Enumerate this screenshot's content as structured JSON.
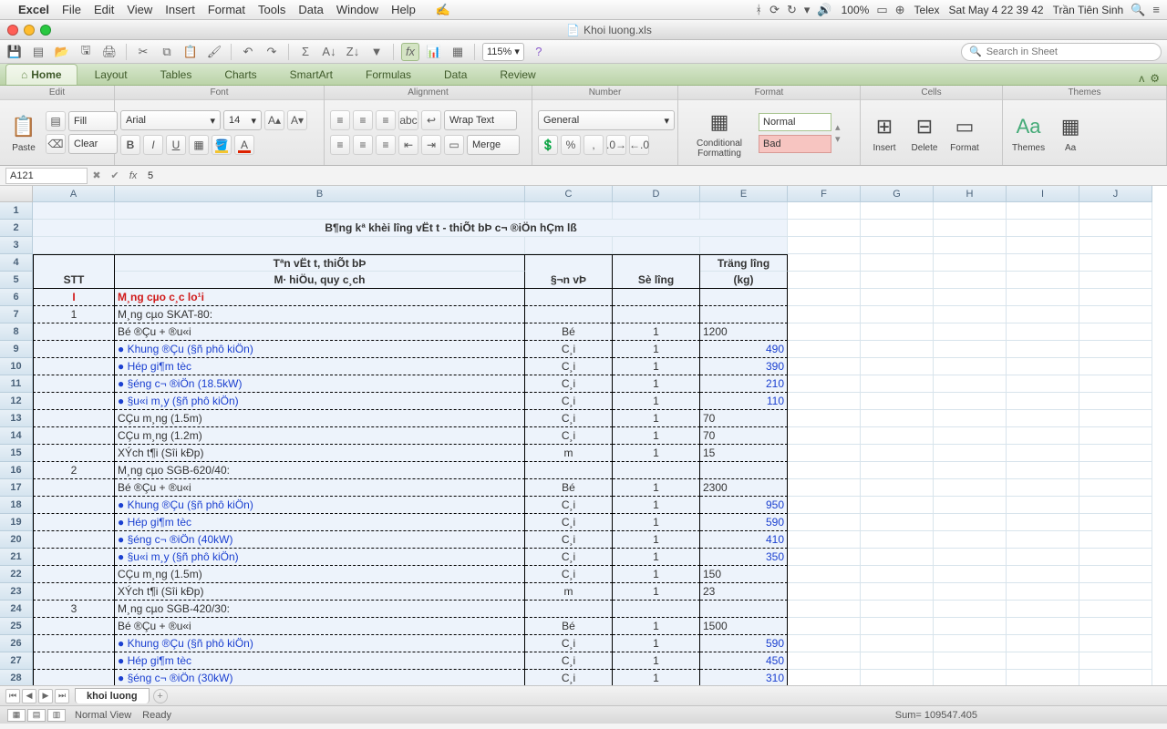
{
  "menubar": {
    "items": [
      "Excel",
      "File",
      "Edit",
      "View",
      "Insert",
      "Format",
      "Tools",
      "Data",
      "Window",
      "Help"
    ],
    "battery": "100%",
    "input": "Telex",
    "clock": "Sat May 4  22 39 42",
    "user": "Trần Tiên Sinh"
  },
  "window": {
    "doc_icon": "xls",
    "title": "Khoi luong.xls"
  },
  "minirow": {
    "zoom": "115%",
    "search_placeholder": "Search in Sheet"
  },
  "tabs": {
    "items": [
      "Home",
      "Layout",
      "Tables",
      "Charts",
      "SmartArt",
      "Formulas",
      "Data",
      "Review"
    ],
    "active": 0
  },
  "ribbon": {
    "groups": [
      "Edit",
      "Font",
      "Alignment",
      "Number",
      "Format",
      "Cells",
      "Themes"
    ],
    "fill_label": "Fill",
    "clear_label": "Clear",
    "paste_label": "Paste",
    "font_name": "Arial",
    "font_size": "14",
    "wrap_label": "Wrap Text",
    "merge_label": "Merge",
    "number_format": "General",
    "cond_label": "Conditional Formatting",
    "styles": [
      "Normal",
      "Bad"
    ],
    "cell_actions": [
      "Insert",
      "Delete",
      "Format"
    ],
    "themes_label": "Themes",
    "aa_label": "Aa"
  },
  "formula": {
    "name": "A121",
    "value": "5"
  },
  "columns": [
    "A",
    "B",
    "C",
    "D",
    "E",
    "F",
    "G",
    "H",
    "I",
    "J"
  ],
  "rownums": [
    1,
    2,
    3,
    4,
    5,
    6,
    7,
    8,
    9,
    10,
    11,
    12,
    13,
    14,
    15,
    16,
    17,
    18,
    19,
    20,
    21,
    22,
    23,
    24,
    25,
    26,
    27,
    28
  ],
  "titlecell": "B¶ng kª khèi l­îng vËt t­ - thiÕt bÞ c¬ ®iÖn hÇm lß",
  "headers": {
    "stt": "STT",
    "desc1": "Tªn vËt t­, thiÕt bÞ",
    "desc2": "M∙ hiÖu, quy c¸ch",
    "unit": "§¬n vÞ",
    "qty": "Sè l­îng",
    "wt1": "Träng l­îng",
    "wt2": "(kg)"
  },
  "rows": [
    {
      "r": 6,
      "stt": "I",
      "desc": "M¸ng cµo c¸c lo¹i",
      "cls": "red bold peach",
      "dash": true
    },
    {
      "r": 7,
      "stt": "1",
      "desc": "M¸ng cµo SKAT-80:",
      "dash": true
    },
    {
      "r": 8,
      "desc": "Bé ®Çu + ®u«i",
      "unit": "Bé",
      "qty": "1",
      "wt": "1200",
      "dash": true
    },
    {
      "r": 9,
      "desc": "     ● Khung ®Çu (§ñ phô kiÖn)",
      "unit": "C¸i",
      "qty": "1",
      "wt": "490",
      "wtright": true,
      "cls": "blue",
      "dash": true
    },
    {
      "r": 10,
      "desc": "     ● Hép gi¶m tèc",
      "unit": "C¸i",
      "qty": "1",
      "wt": "390",
      "wtright": true,
      "cls": "blue",
      "dash": true
    },
    {
      "r": 11,
      "desc": "     ● §éng c¬ ®iÖn (18.5kW)",
      "unit": "C¸i",
      "qty": "1",
      "wt": "210",
      "wtright": true,
      "cls": "blue",
      "dash": true
    },
    {
      "r": 12,
      "desc": "     ● §u«i m¸y (§ñ phô kiÖn)",
      "unit": "C¸i",
      "qty": "1",
      "wt": "110",
      "wtright": true,
      "cls": "blue",
      "dash": true
    },
    {
      "r": 13,
      "desc": "CÇu m¸ng (1.5m)",
      "unit": "C¸i",
      "qty": "1",
      "wt": "70",
      "dash": true
    },
    {
      "r": 14,
      "desc": "CÇu m¸ng (1.2m)",
      "unit": "C¸i",
      "qty": "1",
      "wt": "70",
      "dash": true
    },
    {
      "r": 15,
      "desc": "XÝch t¶i (Sîi kÐp)",
      "unit": "m",
      "qty": "1",
      "wt": "15",
      "dash": true
    },
    {
      "r": 16,
      "stt": "2",
      "desc": "M¸ng cµo SGB-620/40:",
      "dash": true
    },
    {
      "r": 17,
      "desc": "Bé ®Çu + ®u«i",
      "unit": "Bé",
      "qty": "1",
      "wt": "2300",
      "dash": true
    },
    {
      "r": 18,
      "desc": "     ● Khung ®Çu (§ñ phô kiÖn)",
      "unit": "C¸i",
      "qty": "1",
      "wt": "950",
      "wtright": true,
      "cls": "blue",
      "dash": true
    },
    {
      "r": 19,
      "desc": "     ● Hép gi¶m tèc",
      "unit": "C¸i",
      "qty": "1",
      "wt": "590",
      "wtright": true,
      "cls": "blue",
      "dash": true
    },
    {
      "r": 20,
      "desc": "     ● §éng c¬ ®iÖn (40kW)",
      "unit": "C¸i",
      "qty": "1",
      "wt": "410",
      "wtright": true,
      "cls": "blue",
      "dash": true
    },
    {
      "r": 21,
      "desc": "     ● §u«i m¸y (§ñ phô kiÖn)",
      "unit": "C¸i",
      "qty": "1",
      "wt": "350",
      "wtright": true,
      "cls": "blue",
      "dash": true
    },
    {
      "r": 22,
      "desc": "CÇu m¸ng (1.5m)",
      "unit": "C¸i",
      "qty": "1",
      "wt": "150",
      "dash": true
    },
    {
      "r": 23,
      "desc": "XÝch t¶i (Sîi kÐp)",
      "unit": "m",
      "qty": "1",
      "wt": "23",
      "dash": true
    },
    {
      "r": 24,
      "stt": "3",
      "desc": "M¸ng cµo SGB-420/30:",
      "dash": true
    },
    {
      "r": 25,
      "desc": "Bé ®Çu + ®u«i",
      "unit": "Bé",
      "qty": "1",
      "wt": "1500",
      "dash": true
    },
    {
      "r": 26,
      "desc": "     ● Khung ®Çu (§ñ phô kiÖn)",
      "unit": "C¸i",
      "qty": "1",
      "wt": "590",
      "wtright": true,
      "cls": "blue",
      "dash": true
    },
    {
      "r": 27,
      "desc": "     ● Hép gi¶m tèc",
      "unit": "C¸i",
      "qty": "1",
      "wt": "450",
      "wtright": true,
      "cls": "blue",
      "dash": true
    },
    {
      "r": 28,
      "desc": "     ● §éng c¬ ®iÖn (30kW)",
      "unit": "C¸i",
      "qty": "1",
      "wt": "310",
      "wtright": true,
      "cls": "blue",
      "dash": true
    }
  ],
  "sheettab": "khoi luong",
  "status": {
    "view": "Normal View",
    "ready": "Ready",
    "sum": "Sum= 109547.405"
  }
}
